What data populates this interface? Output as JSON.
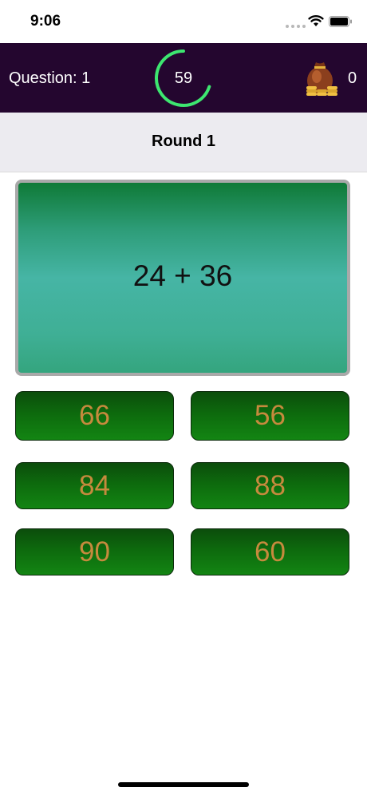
{
  "status_bar": {
    "time": "9:06"
  },
  "header": {
    "question_label": "Question: 1",
    "timer_value": "59",
    "timer_fraction": 0.7,
    "coins": "0",
    "colors": {
      "background": "#24062f",
      "timer_ring": "#3de670"
    }
  },
  "round": {
    "title": "Round 1"
  },
  "question": {
    "text": "24 + 36"
  },
  "answers": [
    "66",
    "56",
    "84",
    "88",
    "90",
    "60"
  ],
  "colors": {
    "answer_text": "#c68a3d",
    "answer_bg": "#0d6a0d"
  }
}
